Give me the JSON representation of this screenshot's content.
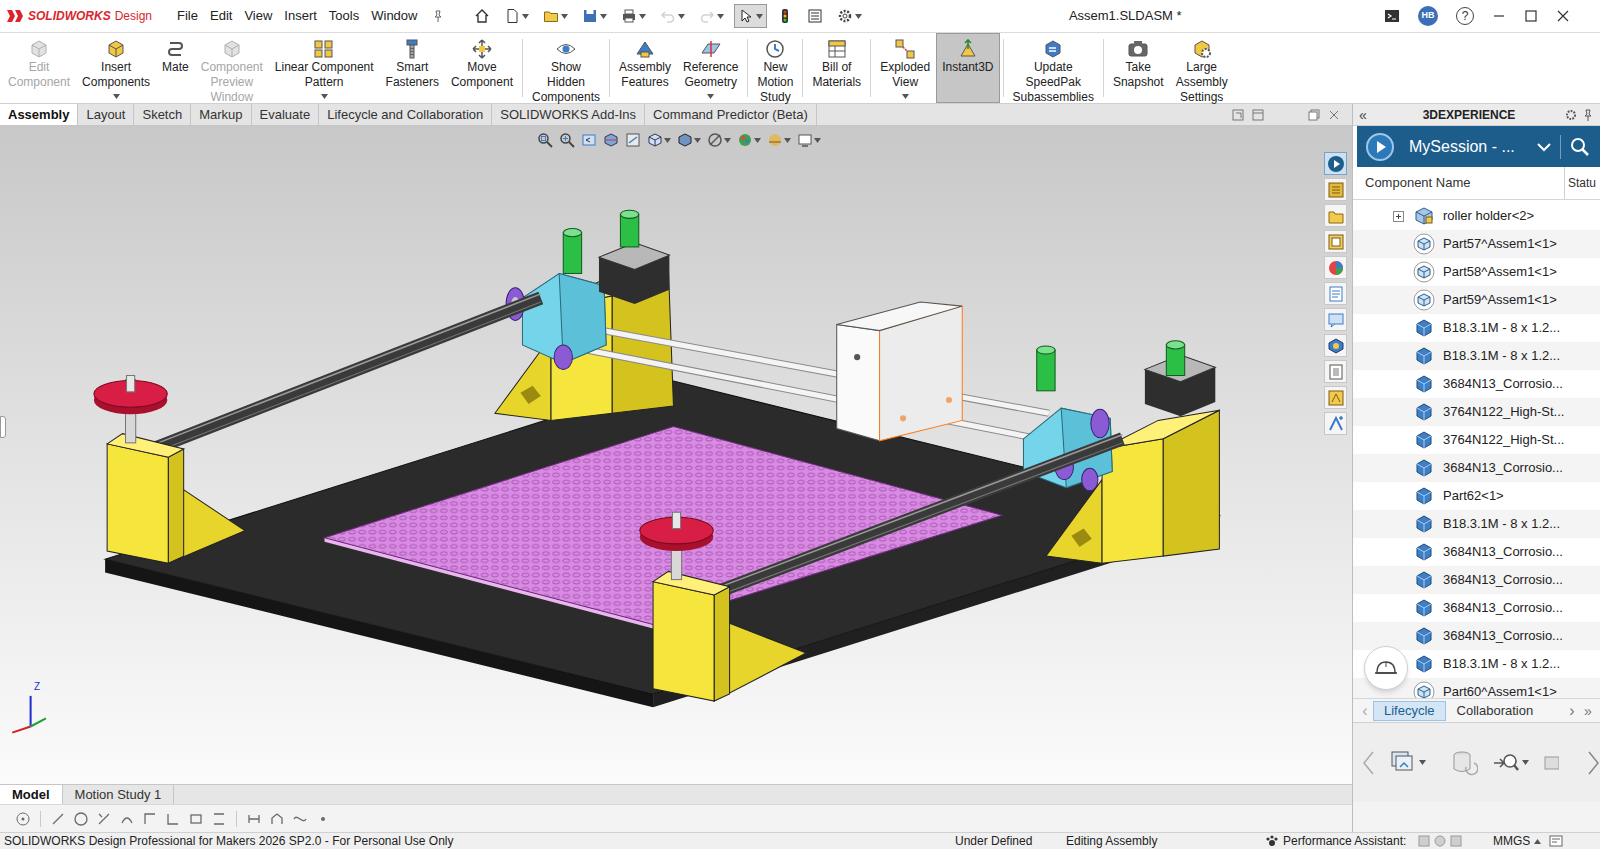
{
  "window": {
    "title": "Assem1.SLDASM *"
  },
  "logo": {
    "brand": "SOLIDWORKS",
    "product": "Design"
  },
  "menu": [
    "File",
    "Edit",
    "View",
    "Insert",
    "Tools",
    "Window"
  ],
  "quick_access": [
    {
      "disabled": false,
      "selected": false
    },
    {
      "disabled": false,
      "selected": false
    },
    {
      "disabled": false,
      "selected": false
    },
    {
      "disabled": false,
      "selected": false
    },
    {
      "disabled": false,
      "selected": false
    },
    {
      "disabled": true,
      "selected": false
    },
    {
      "disabled": true,
      "selected": false
    },
    {
      "disabled": false,
      "selected": true
    },
    {
      "disabled": false,
      "selected": false
    },
    {
      "disabled": false,
      "selected": false
    },
    {
      "disabled": false,
      "selected": false
    }
  ],
  "account": {
    "initials": "HB",
    "help": "?"
  },
  "ribbon": [
    [
      {
        "lines": [
          "Edit",
          "Component"
        ],
        "disabled": true,
        "selected": false,
        "dropdown": false
      },
      {
        "lines": [
          "Insert",
          "Components"
        ],
        "disabled": false,
        "selected": false,
        "dropdown": true
      },
      {
        "lines": [
          "Mate"
        ],
        "disabled": false,
        "selected": false,
        "dropdown": false
      },
      {
        "lines": [
          "Component",
          "Preview",
          "Window"
        ],
        "disabled": true,
        "selected": false,
        "dropdown": false
      },
      {
        "lines": [
          "Linear Component",
          "Pattern"
        ],
        "disabled": false,
        "selected": false,
        "dropdown": true
      },
      {
        "lines": [
          "Smart",
          "Fasteners"
        ],
        "disabled": false,
        "selected": false,
        "dropdown": false
      },
      {
        "lines": [
          "Move",
          "Component"
        ],
        "disabled": false,
        "selected": false,
        "dropdown": false
      }
    ],
    [
      {
        "lines": [
          "Show",
          "Hidden",
          "Components"
        ],
        "disabled": false,
        "selected": false,
        "dropdown": false
      }
    ],
    [
      {
        "lines": [
          "Assembly",
          "Features"
        ],
        "disabled": false,
        "selected": false,
        "dropdown": false
      },
      {
        "lines": [
          "Reference",
          "Geometry"
        ],
        "disabled": false,
        "selected": false,
        "dropdown": true
      }
    ],
    [
      {
        "lines": [
          "New",
          "Motion",
          "Study"
        ],
        "disabled": false,
        "selected": false,
        "dropdown": false
      }
    ],
    [
      {
        "lines": [
          "Bill of",
          "Materials"
        ],
        "disabled": false,
        "selected": false,
        "dropdown": false
      }
    ],
    [
      {
        "lines": [
          "Exploded",
          "View"
        ],
        "disabled": false,
        "selected": false,
        "dropdown": true
      },
      {
        "lines": [
          "Instant3D"
        ],
        "disabled": false,
        "selected": true,
        "dropdown": false
      }
    ],
    [
      {
        "lines": [
          "Update",
          "SpeedPak",
          "Subassemblies"
        ],
        "disabled": false,
        "selected": false,
        "dropdown": false
      }
    ],
    [
      {
        "lines": [
          "Take",
          "Snapshot"
        ],
        "disabled": false,
        "selected": false,
        "dropdown": false
      },
      {
        "lines": [
          "Large",
          "Assembly",
          "Settings"
        ],
        "disabled": false,
        "selected": false,
        "dropdown": false
      }
    ]
  ],
  "command_tabs": [
    {
      "label": "Assembly",
      "selected": true
    },
    {
      "label": "Layout",
      "selected": false
    },
    {
      "label": "Sketch",
      "selected": false
    },
    {
      "label": "Markup",
      "selected": false
    },
    {
      "label": "Evaluate",
      "selected": false
    },
    {
      "label": "Lifecycle and Collaboration",
      "selected": false
    },
    {
      "label": "SOLIDWORKS Add-Ins",
      "selected": false
    },
    {
      "label": "Command Predictor (Beta)",
      "selected": false
    }
  ],
  "task_pane_strip": [
    {
      "selected": true
    },
    {
      "selected": false
    },
    {
      "selected": false
    },
    {
      "selected": false
    },
    {
      "selected": false
    },
    {
      "selected": false
    },
    {
      "selected": false
    },
    {
      "selected": false
    },
    {
      "selected": false
    },
    {
      "selected": false
    },
    {
      "selected": false
    }
  ],
  "triad": {
    "z": "Z"
  },
  "document_tabs": [
    {
      "label": "Model",
      "selected": true
    },
    {
      "label": "Motion Study 1",
      "selected": false
    }
  ],
  "task_pane": {
    "collapse": "«",
    "title": "3DEXPERIENCE",
    "session": "MySession - ...",
    "columns": [
      "Component Name",
      "Statu"
    ],
    "rows": [
      {
        "name": "roller holder<2>",
        "kind": "assembly",
        "expandable": true,
        "expanded": false
      },
      {
        "name": "Part57^Assem1<1>",
        "kind": "linked",
        "expandable": false,
        "expanded": false
      },
      {
        "name": "Part58^Assem1<1>",
        "kind": "linked",
        "expandable": false,
        "expanded": false
      },
      {
        "name": "Part59^Assem1<1>",
        "kind": "linked",
        "expandable": false,
        "expanded": false
      },
      {
        "name": "B18.3.1M - 8 x 1.2...",
        "kind": "part",
        "expandable": false,
        "expanded": false
      },
      {
        "name": "B18.3.1M - 8 x 1.2...",
        "kind": "part",
        "expandable": false,
        "expanded": false
      },
      {
        "name": "3684N13_Corrosio...",
        "kind": "part",
        "expandable": false,
        "expanded": false
      },
      {
        "name": "3764N122_High-St...",
        "kind": "part",
        "expandable": false,
        "expanded": false
      },
      {
        "name": "3764N122_High-St...",
        "kind": "part",
        "expandable": false,
        "expanded": false
      },
      {
        "name": "3684N13_Corrosio...",
        "kind": "part",
        "expandable": false,
        "expanded": false
      },
      {
        "name": "Part62<1>",
        "kind": "part",
        "expandable": false,
        "expanded": false
      },
      {
        "name": "B18.3.1M - 8 x 1.2...",
        "kind": "part",
        "expandable": false,
        "expanded": false
      },
      {
        "name": "3684N13_Corrosio...",
        "kind": "part",
        "expandable": false,
        "expanded": false
      },
      {
        "name": "3684N13_Corrosio...",
        "kind": "part",
        "expandable": false,
        "expanded": false
      },
      {
        "name": "3684N13_Corrosio...",
        "kind": "part",
        "expandable": false,
        "expanded": false
      },
      {
        "name": "3684N13_Corrosio...",
        "kind": "part",
        "expandable": false,
        "expanded": false
      },
      {
        "name": "B18.3.1M - 8 x 1.2...",
        "kind": "part",
        "expandable": false,
        "expanded": false
      },
      {
        "name": "Part60^Assem1<1>",
        "kind": "linked",
        "expandable": false,
        "expanded": false
      }
    ],
    "tab_arrows": [
      "‹",
      "›",
      "»"
    ],
    "tabs": [
      {
        "label": "Lifecycle",
        "selected": true
      },
      {
        "label": "Collaboration",
        "selected": false
      }
    ]
  },
  "status_bar": {
    "product": "SOLIDWORKS Design Professional for Makers 2026 SP2.0 - For Personal Use Only",
    "state": "Under Defined",
    "mode": "Editing Assembly",
    "assistant": "Performance Assistant:",
    "units": "MMGS"
  }
}
